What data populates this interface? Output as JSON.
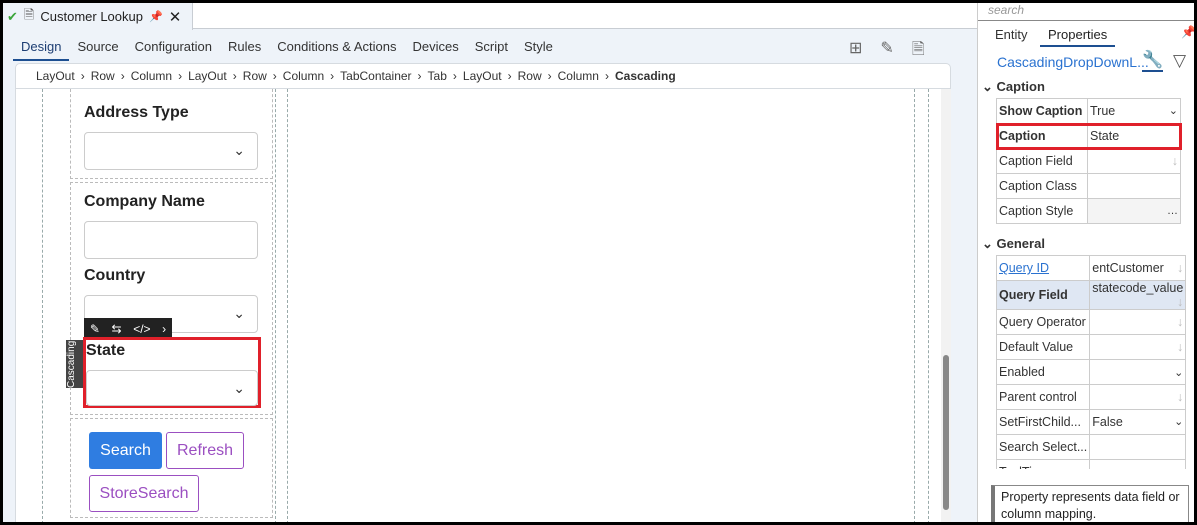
{
  "doc_tab": {
    "title": "Customer Lookup"
  },
  "nav_tabs": [
    "Design",
    "Source",
    "Configuration",
    "Rules",
    "Conditions & Actions",
    "Devices",
    "Script",
    "Style"
  ],
  "breadcrumb": [
    "LayOut",
    "Row",
    "Column",
    "LayOut",
    "Row",
    "Column",
    "TabContainer",
    "Tab",
    "LayOut",
    "Row",
    "Column"
  ],
  "breadcrumb_current": "Cascading",
  "form": {
    "address_type": "Address Type",
    "company_name": "Company Name",
    "country": "Country",
    "state": "State",
    "cascading_tag": "Cascading",
    "search": "Search",
    "refresh": "Refresh",
    "store_search": "StoreSearch"
  },
  "panel": {
    "search_placeholder": "search",
    "tabs": [
      "Entity",
      "Properties"
    ],
    "control_name": "CascadingDropDownL...",
    "caption_section": "Caption",
    "general_section": "General",
    "caption_rows": [
      {
        "k": "Show Caption",
        "v": "True"
      },
      {
        "k": "Caption",
        "v": "State"
      },
      {
        "k": "Caption Field",
        "v": ""
      },
      {
        "k": "Caption Class",
        "v": ""
      },
      {
        "k": "Caption Style",
        "v": ""
      }
    ],
    "general_rows": [
      {
        "k": "Query ID",
        "v": "entCustomer"
      },
      {
        "k": "Query Field",
        "v": "statecode_value"
      },
      {
        "k": "Query Operator",
        "v": ""
      },
      {
        "k": "Default Value",
        "v": ""
      },
      {
        "k": "Enabled",
        "v": ""
      },
      {
        "k": "Parent control",
        "v": ""
      },
      {
        "k": "SetFirstChild...",
        "v": "False"
      },
      {
        "k": "Search Select...",
        "v": ""
      },
      {
        "k": "ToolTip",
        "v": ""
      }
    ],
    "help": "Property represents data field or column mapping."
  },
  "colors": {
    "accent": "#1d4f91",
    "primary_btn": "#2f7de1",
    "outline_btn": "#9b4fc1",
    "highlight": "#e0202a"
  }
}
